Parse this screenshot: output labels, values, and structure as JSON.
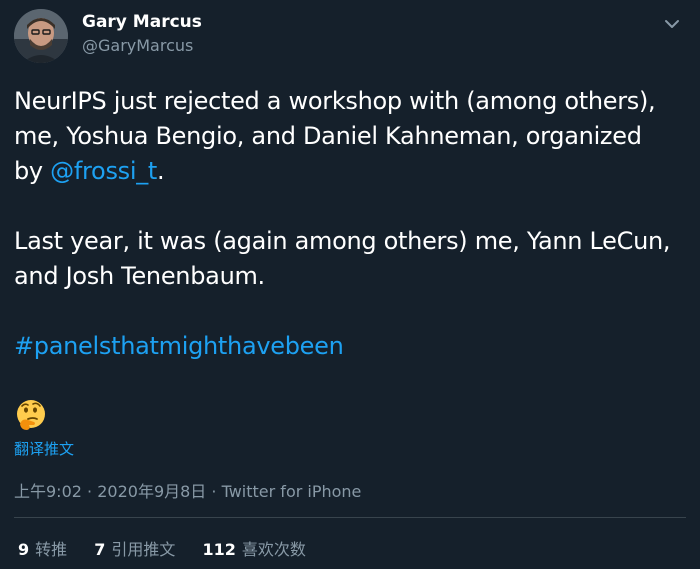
{
  "author": {
    "name": "Gary Marcus",
    "handle": "@GaryMarcus"
  },
  "tweet": {
    "line1": "NeurIPS just rejected a workshop with (among others),",
    "line2": "me, Yoshua Bengio, and Daniel Kahneman, organized",
    "line3_prefix": "by ",
    "mention": "@frossi_t",
    "line3_suffix": ".",
    "line4": "Last year, it was (again among others) me, Yann LeCun,",
    "line5": "and Josh Tenenbaum.",
    "hashtag": "#panelsthatmighthavebeen",
    "emoji": "thinking-face-icon"
  },
  "translate_label": "翻译推文",
  "meta": {
    "time": "上午9:02",
    "separator1": "·",
    "date": "2020年9月8日",
    "separator2": "·",
    "source": "Twitter for iPhone"
  },
  "stats": {
    "retweets_count": "9",
    "retweets_label": "转推",
    "quotes_count": "7",
    "quotes_label": "引用推文",
    "likes_count": "112",
    "likes_label": "喜欢次数"
  },
  "colors": {
    "background": "#15202b",
    "link": "#1da1f2",
    "muted": "#8899a6",
    "divider": "#38444d"
  }
}
